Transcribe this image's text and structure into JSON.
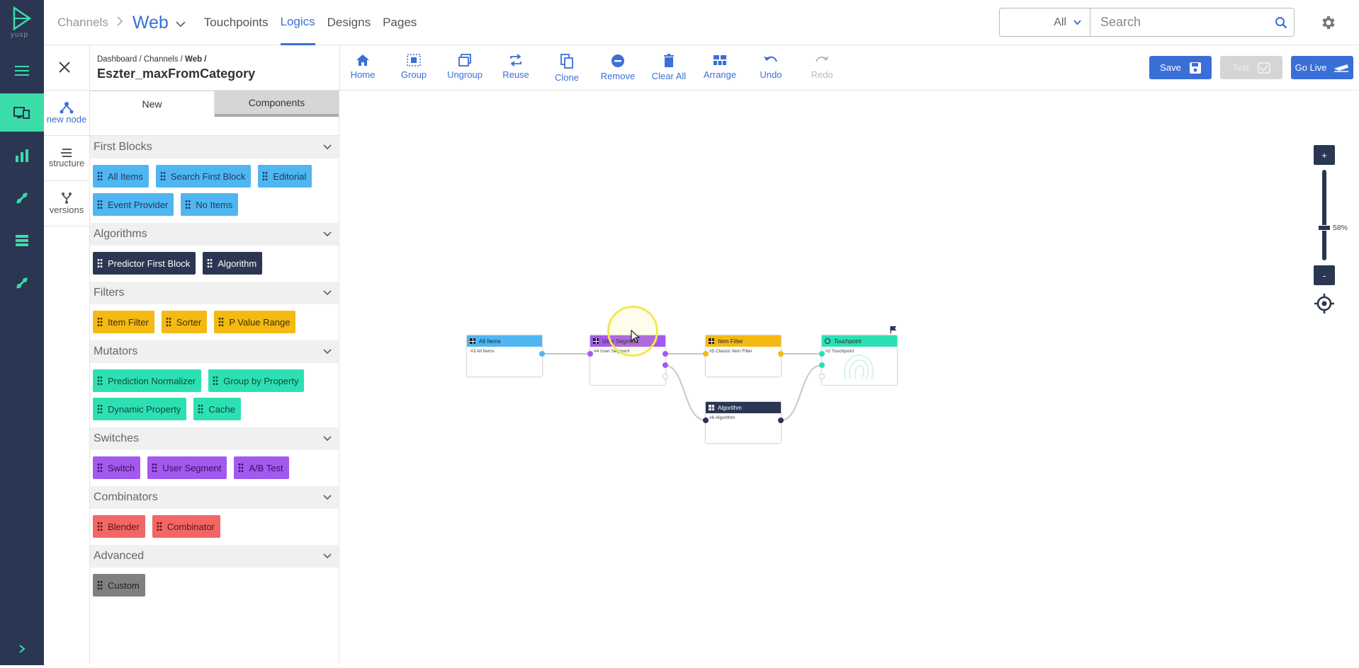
{
  "app": {
    "brand": "yusp"
  },
  "topnav": {
    "breadcrumb_channels": "Channels",
    "current_channel": "Web",
    "tabs": [
      {
        "label": "Touchpoints"
      },
      {
        "label": "Logics"
      },
      {
        "label": "Designs"
      },
      {
        "label": "Pages"
      }
    ],
    "active_tab": "Logics"
  },
  "search": {
    "scope": "All",
    "placeholder": "Search"
  },
  "page": {
    "breadcrumb": {
      "dashboard": "Dashboard /",
      "channels": "Channels /",
      "web": "Web /"
    },
    "title": "Eszter_maxFromCategory"
  },
  "sidetools": {
    "new_node": "new node",
    "structure": "structure",
    "versions": "versions"
  },
  "palette": {
    "tabs": {
      "new": "New",
      "components": "Components"
    },
    "sections": [
      {
        "title": "First Blocks",
        "color": "#4fb6f2",
        "items": [
          "All Items",
          "Search First Block",
          "Editorial",
          "Event Provider",
          "No Items"
        ]
      },
      {
        "title": "Algorithms",
        "color": "#2a3652",
        "items": [
          "Predictor First Block",
          "Algorithm"
        ]
      },
      {
        "title": "Filters",
        "color": "#f5b914",
        "items": [
          "Item Filter",
          "Sorter",
          "P Value Range"
        ]
      },
      {
        "title": "Mutators",
        "color": "#2de0b4",
        "items": [
          "Prediction Normalizer",
          "Group by Property",
          "Dynamic Property",
          "Cache"
        ]
      },
      {
        "title": "Switches",
        "color": "#a459ee",
        "items": [
          "Switch",
          "User Segment",
          "A/B Test"
        ]
      },
      {
        "title": "Combinators",
        "color": "#f26666",
        "items": [
          "Blender",
          "Combinator"
        ]
      },
      {
        "title": "Advanced",
        "color": "#808080",
        "items": [
          "Custom"
        ]
      }
    ]
  },
  "toolbar": {
    "home": "Home",
    "group": "Group",
    "ungroup": "Ungroup",
    "reuse": "Reuse",
    "clone": "Clone",
    "remove": "Remove",
    "clear_all": "Clear All",
    "arrange": "Arrange",
    "undo": "Undo",
    "redo": "Redo",
    "save": "Save",
    "test": "Test",
    "go_live": "Go Live"
  },
  "canvas": {
    "zoom_in": "+",
    "zoom_out": "-",
    "zoom_level": "58%",
    "zoom_fraction": 0.58,
    "nodes": {
      "all_items": {
        "title": "All Items",
        "sub": "#3 All Items",
        "color": "#4fb6f2"
      },
      "user_segment": {
        "title": "User Segment",
        "sub": "#4 User Segment",
        "color": "#a459ee"
      },
      "item_filter": {
        "title": "Item Filter",
        "sub": "#5 Classic Item Filter",
        "color": "#f5b914"
      },
      "algorithm": {
        "title": "Algorithm",
        "sub": "#6 Algorithm",
        "color": "#2a3652"
      },
      "touchpoint": {
        "title": "Touchpoint",
        "sub": "#2 Touchpoint",
        "color": "#2de0b4"
      }
    }
  }
}
